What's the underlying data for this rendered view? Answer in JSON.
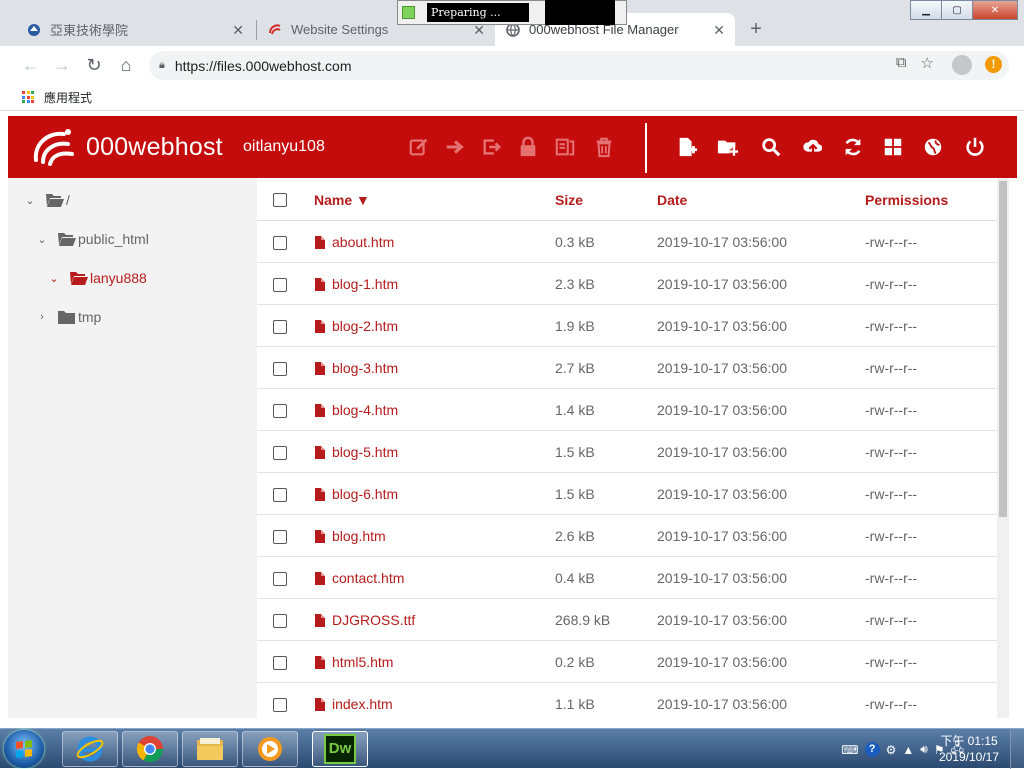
{
  "browser": {
    "tabs": [
      {
        "title": "亞東技術學院",
        "active": false
      },
      {
        "title": "Website Settings",
        "active": false
      },
      {
        "title": "000webhost File Manager",
        "active": true
      }
    ],
    "new_tab": "+",
    "url": "https://files.000webhost.com",
    "bookmarks_label": "應用程式",
    "popup_text": "Preparing ..."
  },
  "app": {
    "brand": "000webhost",
    "username": "oitlanyu108",
    "accent": "#c40c0c",
    "toolbar_left_icons": [
      "edit-icon",
      "move-icon",
      "exit-icon",
      "lock-icon",
      "archive-icon",
      "trash-icon"
    ],
    "toolbar_right_icons": [
      "new-file-icon",
      "new-folder-icon",
      "search-icon",
      "upload-icon",
      "refresh-icon",
      "grid-view-icon",
      "globe-icon",
      "power-icon"
    ]
  },
  "tree": [
    {
      "label": "/",
      "expanded": true
    },
    {
      "label": "public_html",
      "expanded": true
    },
    {
      "label": "lanyu888",
      "expanded": true,
      "active": true
    },
    {
      "label": "tmp",
      "expanded": false
    }
  ],
  "table": {
    "headers": {
      "name": "Name ▼",
      "size": "Size",
      "date": "Date",
      "permissions": "Permissions"
    },
    "rows": [
      {
        "name": "about.htm",
        "size": "0.3 kB",
        "date": "2019-10-17 03:56:00",
        "perm": "-rw-r--r--"
      },
      {
        "name": "blog-1.htm",
        "size": "2.3 kB",
        "date": "2019-10-17 03:56:00",
        "perm": "-rw-r--r--"
      },
      {
        "name": "blog-2.htm",
        "size": "1.9 kB",
        "date": "2019-10-17 03:56:00",
        "perm": "-rw-r--r--"
      },
      {
        "name": "blog-3.htm",
        "size": "2.7 kB",
        "date": "2019-10-17 03:56:00",
        "perm": "-rw-r--r--"
      },
      {
        "name": "blog-4.htm",
        "size": "1.4 kB",
        "date": "2019-10-17 03:56:00",
        "perm": "-rw-r--r--"
      },
      {
        "name": "blog-5.htm",
        "size": "1.5 kB",
        "date": "2019-10-17 03:56:00",
        "perm": "-rw-r--r--"
      },
      {
        "name": "blog-6.htm",
        "size": "1.5 kB",
        "date": "2019-10-17 03:56:00",
        "perm": "-rw-r--r--"
      },
      {
        "name": "blog.htm",
        "size": "2.6 kB",
        "date": "2019-10-17 03:56:00",
        "perm": "-rw-r--r--"
      },
      {
        "name": "contact.htm",
        "size": "0.4 kB",
        "date": "2019-10-17 03:56:00",
        "perm": "-rw-r--r--"
      },
      {
        "name": "DJGROSS.ttf",
        "size": "268.9 kB",
        "date": "2019-10-17 03:56:00",
        "perm": "-rw-r--r--"
      },
      {
        "name": "html5.htm",
        "size": "0.2 kB",
        "date": "2019-10-17 03:56:00",
        "perm": "-rw-r--r--"
      },
      {
        "name": "index.htm",
        "size": "1.1 kB",
        "date": "2019-10-17 03:56:00",
        "perm": "-rw-r--r--"
      }
    ]
  },
  "taskbar": {
    "items": [
      "internet-explorer",
      "chrome",
      "file-explorer",
      "media-player",
      "dreamweaver"
    ],
    "dreamweaver_label": "Dw",
    "clock_time": "下午 01:15",
    "clock_date": "2019/10/17"
  }
}
